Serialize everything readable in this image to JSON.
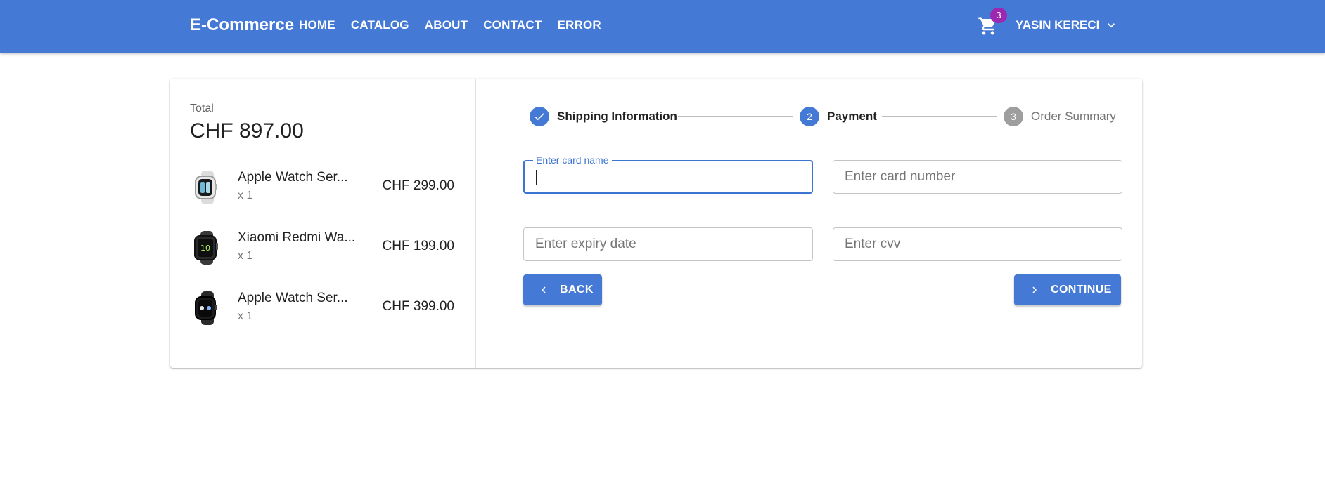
{
  "header": {
    "brand": "E-Commerce",
    "nav": [
      "HOME",
      "CATALOG",
      "ABOUT",
      "CONTACT",
      "ERROR"
    ],
    "cart_count": "3",
    "user_name": "YASIN KERECI",
    "icons": {
      "cart": "shopping-cart-icon",
      "user_menu": "chevron-down-icon"
    }
  },
  "summary": {
    "total_label": "Total",
    "total_value": "CHF 897.00",
    "items": [
      {
        "name": "Apple Watch Ser...",
        "qty": "x 1",
        "price": "CHF 299.00",
        "thumb": "silver-watch"
      },
      {
        "name": "Xiaomi Redmi Wa...",
        "qty": "x 1",
        "price": "CHF 199.00",
        "thumb": "black-band"
      },
      {
        "name": "Apple Watch Ser...",
        "qty": "x 1",
        "price": "CHF 399.00",
        "thumb": "black-watch"
      }
    ]
  },
  "stepper": {
    "steps": [
      {
        "label": "Shipping Information",
        "number": "",
        "state": "completed"
      },
      {
        "label": "Payment",
        "number": "2",
        "state": "active"
      },
      {
        "label": "Order Summary",
        "number": "3",
        "state": "inactive"
      }
    ]
  },
  "form": {
    "card_name": {
      "label": "Enter card name",
      "value": ""
    },
    "card_number": {
      "placeholder": "Enter card number",
      "value": ""
    },
    "expiry": {
      "placeholder": "Enter expiry date",
      "value": ""
    },
    "cvv": {
      "placeholder": "Enter cvv",
      "value": ""
    }
  },
  "actions": {
    "back": "BACK",
    "continue": "CONTINUE"
  },
  "colors": {
    "primary": "#4479d6",
    "badge": "#9c27b0",
    "inactive_step": "#9e9e9e",
    "focus": "#3b74d1"
  }
}
